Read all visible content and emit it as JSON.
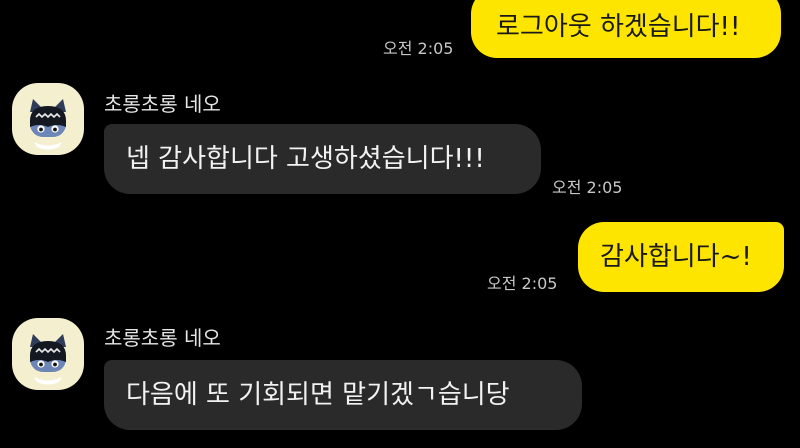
{
  "colors": {
    "background": "#000000",
    "outgoing_bubble": "#fee500",
    "incoming_bubble": "#2a2a2a",
    "timestamp": "#c7c7c7"
  },
  "messages": [
    {
      "direction": "outgoing",
      "text": "로그아웃 하겠습니다!!",
      "time": "오전 2:05"
    },
    {
      "direction": "incoming",
      "sender": "초롱초롱 네오",
      "avatar_icon": "neo-character-icon",
      "text": "넵 감사합니다 고생하셨습니다!!!",
      "time": "오전 2:05"
    },
    {
      "direction": "outgoing",
      "text": "감사합니다~!",
      "time": "오전 2:05"
    },
    {
      "direction": "incoming",
      "sender": "초롱초롱 네오",
      "avatar_icon": "neo-character-icon",
      "text": "다음에 또 기회되면 맡기겠ㄱ습니당"
    }
  ]
}
